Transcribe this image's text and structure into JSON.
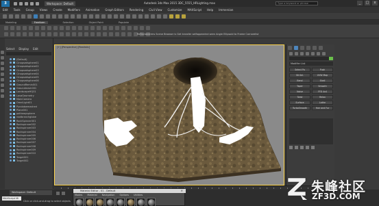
{
  "title_bar": {
    "app_icon": "3",
    "workspace": "Workspace: Default",
    "title": "Autodesk 3ds Max 2015    3DC_5555_HRLighting.max",
    "search_placeholder": "Type a keyword or phrase",
    "minimize": "_",
    "maximize": "□",
    "close": "x"
  },
  "menu": [
    "Edit",
    "Tools",
    "Group",
    "Views",
    "Create",
    "Modifiers",
    "Animation",
    "Graph Editors",
    "Rendering",
    "Civil View",
    "Customize",
    "MAXScript",
    "Help",
    "Immersion"
  ],
  "ribbon": {
    "tabs": [
      "Modeling",
      "Freeform",
      "Selection",
      "Object Paint",
      "Populate"
    ],
    "active_tab": "Freeform",
    "info_text": "Reflectablerms Scene Browser is Get transfer selfappearind seen Angle Ellipsoid to Frame Cornarelist"
  },
  "scene_explorer": {
    "menu": [
      "Select",
      "Display",
      "Edit"
    ],
    "items": [
      "(Default)",
      "Cinapsedsphere01",
      "Cinapsedsphere02",
      "Cinapsedsphere03",
      "Cinapsedsphere04",
      "Cinapsedsphere05",
      "Cinapsedsphere06",
      "GroundRemin001",
      "Groundmesh001",
      "LandscapeHQ01",
      "LavaGeometry",
      "MainCamera",
      "OmniLight01",
      "Pyrolobwmashed",
      "Plane001",
      "pathwaysphere",
      "rootbranchglobe",
      "RockSpinner001",
      "Rockspinner002",
      "Rockspinner003",
      "Rockspinner004",
      "Rockspinner005",
      "Rockspinner006",
      "Rockspinner007",
      "Rockspinner008",
      "Rockspinner009",
      "Rockspinner010",
      "Target001",
      "Target002"
    ]
  },
  "viewport": {
    "label": "[+] [Perspective] [Realistic]"
  },
  "command_panel": {
    "modifier_list": "Modifier List",
    "buttons": [
      "Select Po",
      "Push",
      "Stl.Sel.",
      "UVW Map",
      "Bend",
      "Shell",
      "Taper",
      "Smooth",
      "Noise",
      "FFD 4x4",
      "Twist",
      "Relax",
      "Surface",
      "Lathe",
      "TurboSmooth",
      "Hair and Fur"
    ]
  },
  "status_bar": {
    "workspace_tab": "Workspace: Default",
    "maxscript": "MAXScript Mi",
    "message": "Click or click-and-drag to select objects"
  },
  "material_editor": {
    "title": "Material Editor - 01 - Default",
    "menu": [
      "Modes",
      "Material",
      "Navigation",
      "Options",
      "Utilities"
    ],
    "close": "×",
    "slot_count": 8
  },
  "watermark": {
    "chinese": "朱峰社区",
    "english": "ZF3D.COM"
  },
  "colors": {
    "viewport_border": "#ffd54a",
    "accent_blue": "#3d7fb8",
    "terrain": "#6b5a3d"
  }
}
